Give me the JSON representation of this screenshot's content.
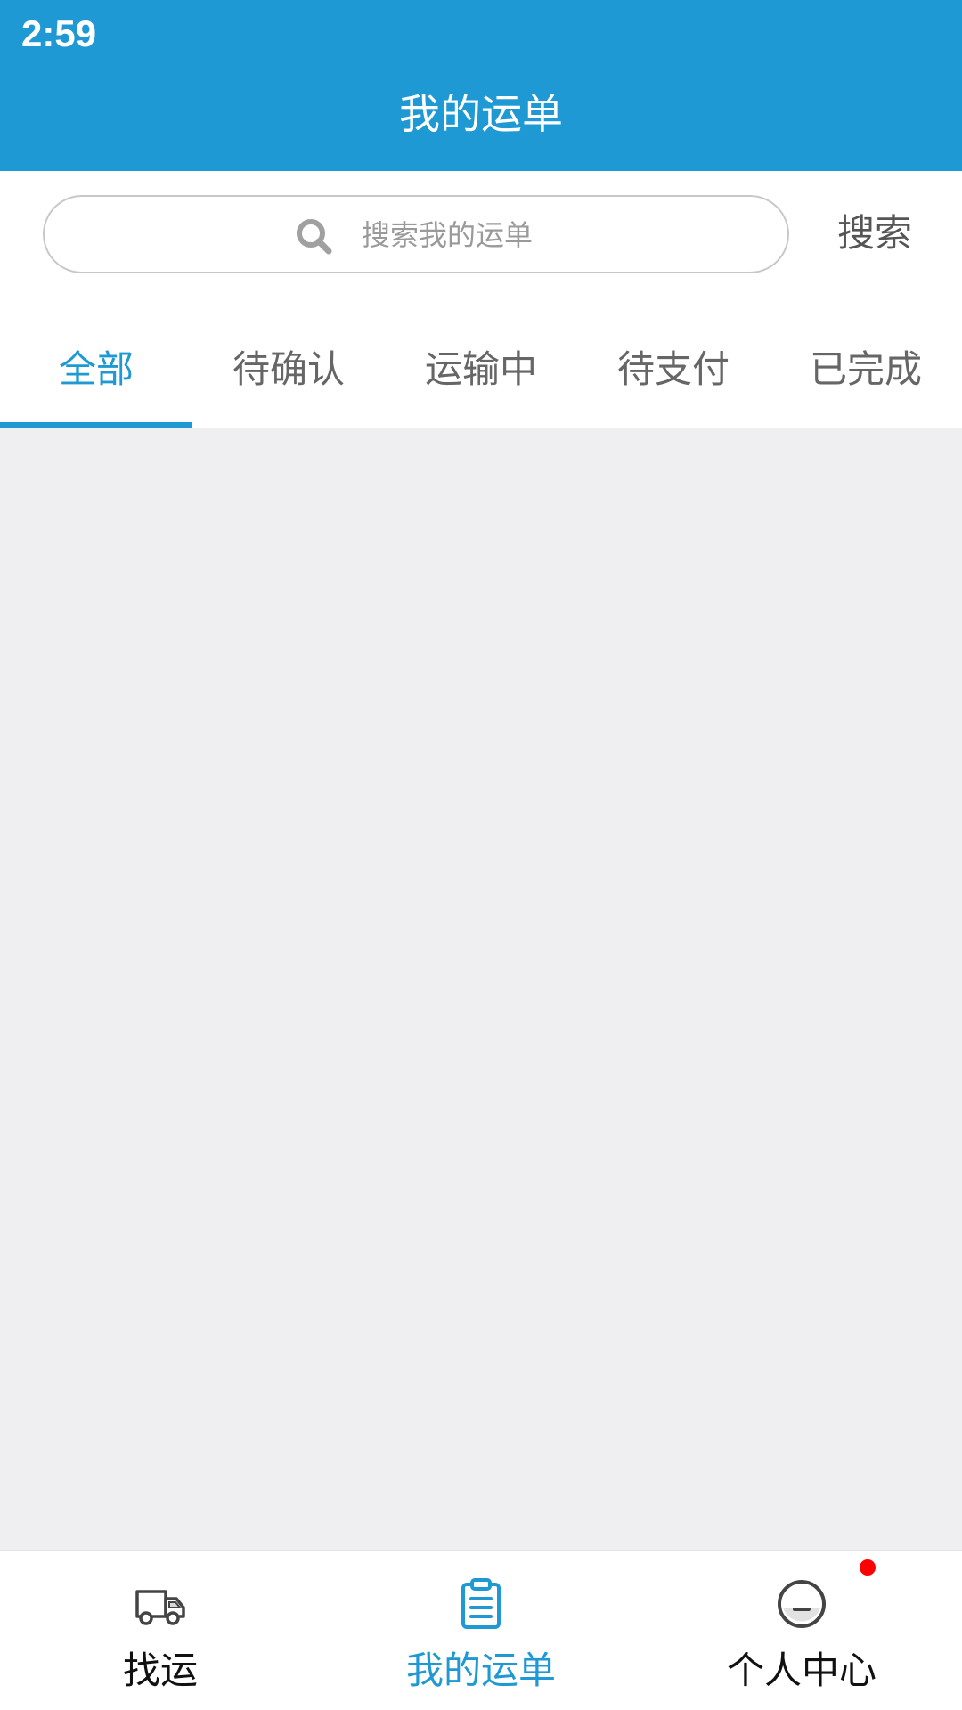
{
  "status_bar": {
    "time": "2:59"
  },
  "header": {
    "title": "我的运单"
  },
  "search": {
    "placeholder": "搜索我的运单",
    "button_label": "搜索"
  },
  "tabs": [
    {
      "label": "全部",
      "active": true
    },
    {
      "label": "待确认",
      "active": false
    },
    {
      "label": "运输中",
      "active": false
    },
    {
      "label": "待支付",
      "active": false
    },
    {
      "label": "已完成",
      "active": false
    }
  ],
  "bottom_nav": [
    {
      "label": "找运",
      "icon": "truck-icon",
      "active": false
    },
    {
      "label": "我的运单",
      "icon": "clipboard-icon",
      "active": true
    },
    {
      "label": "个人中心",
      "icon": "profile-face-icon",
      "active": false,
      "badge": true
    }
  ],
  "colors": {
    "brand_blue": "#1e99d4",
    "background": "#efeef1",
    "badge_red": "#ff0000"
  }
}
